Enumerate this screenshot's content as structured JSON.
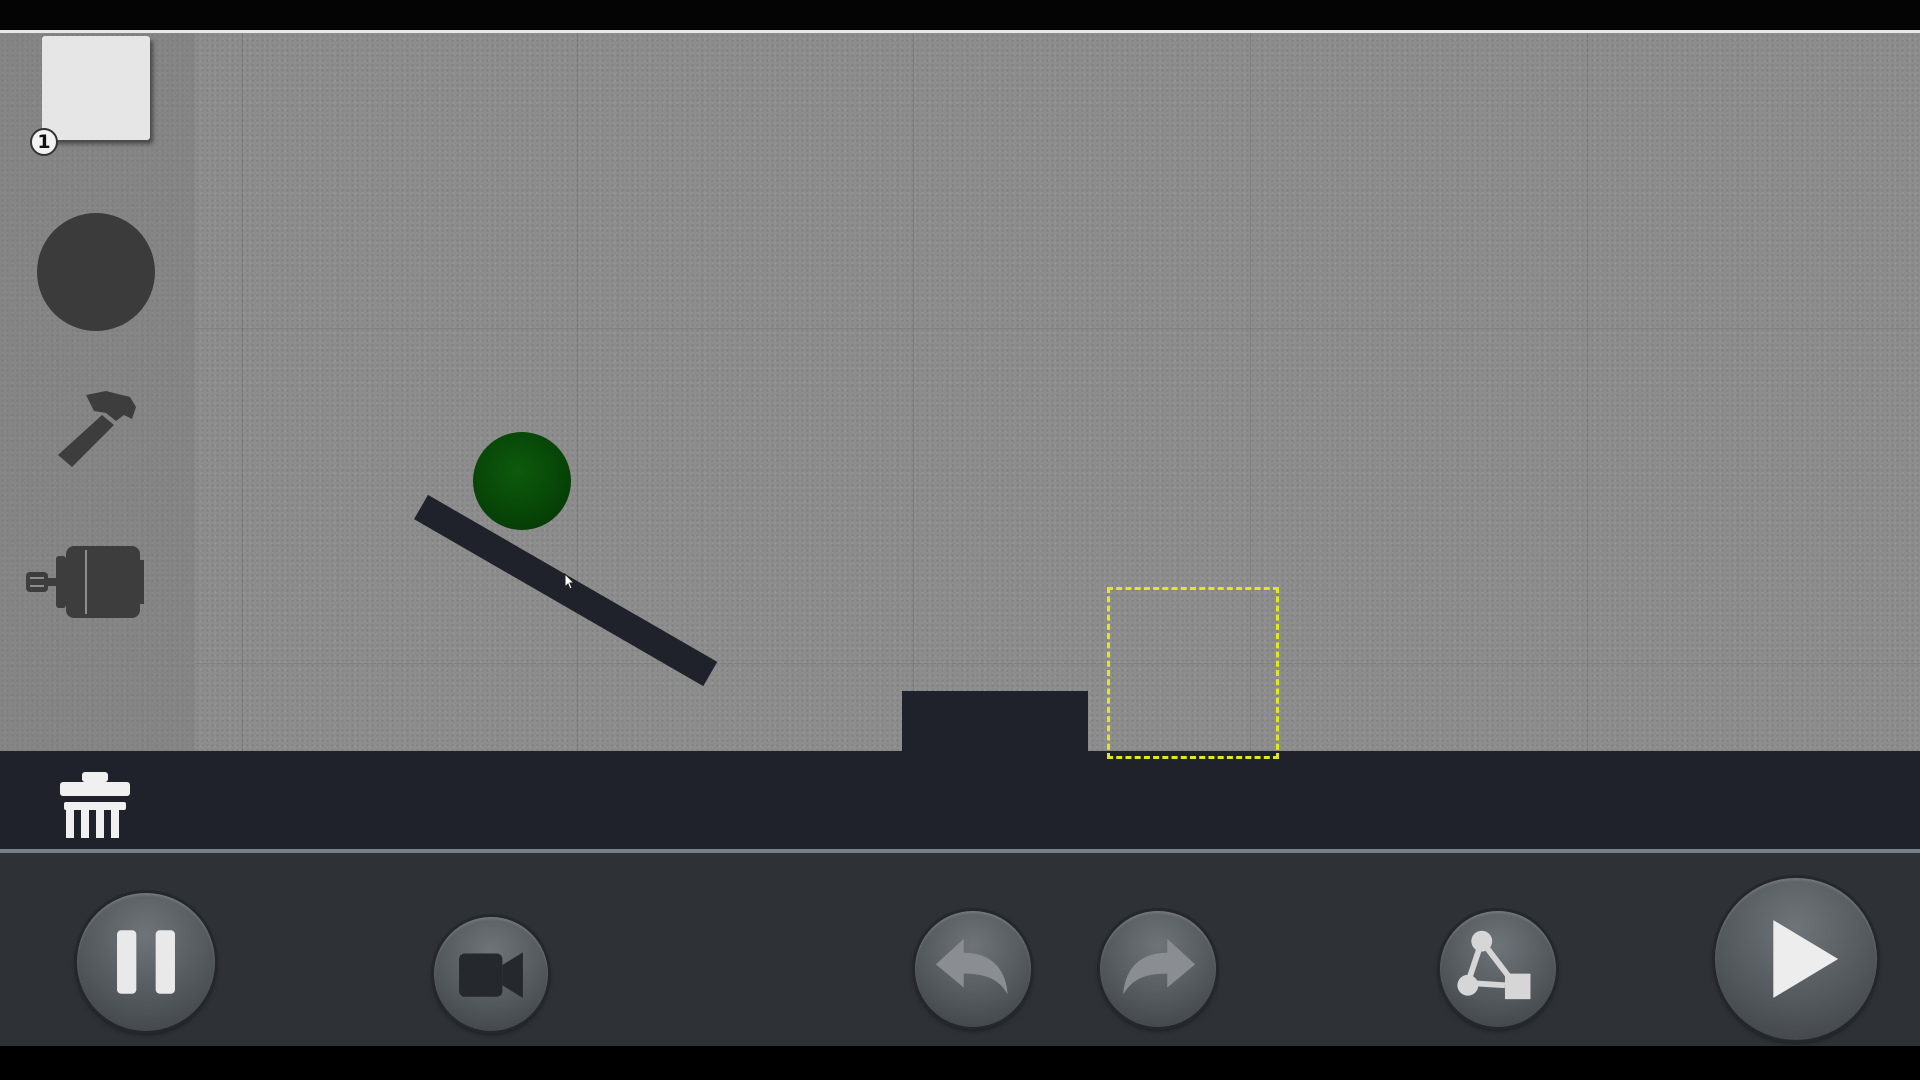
{
  "palette": {
    "box_count": "1"
  },
  "colors": {
    "ball": "#064006",
    "target_outline": "#e2e820",
    "ground": "#1f222a",
    "toolbar": "#2e3236",
    "background": "#8d8d8d"
  },
  "icons": {
    "palette": [
      "box-icon",
      "circle-icon",
      "hammer-icon",
      "motor-icon",
      "trash-icon"
    ],
    "toolbar": [
      "pause-icon",
      "camera-icon",
      "undo-icon",
      "redo-icon",
      "joint-icon",
      "play-icon"
    ]
  }
}
